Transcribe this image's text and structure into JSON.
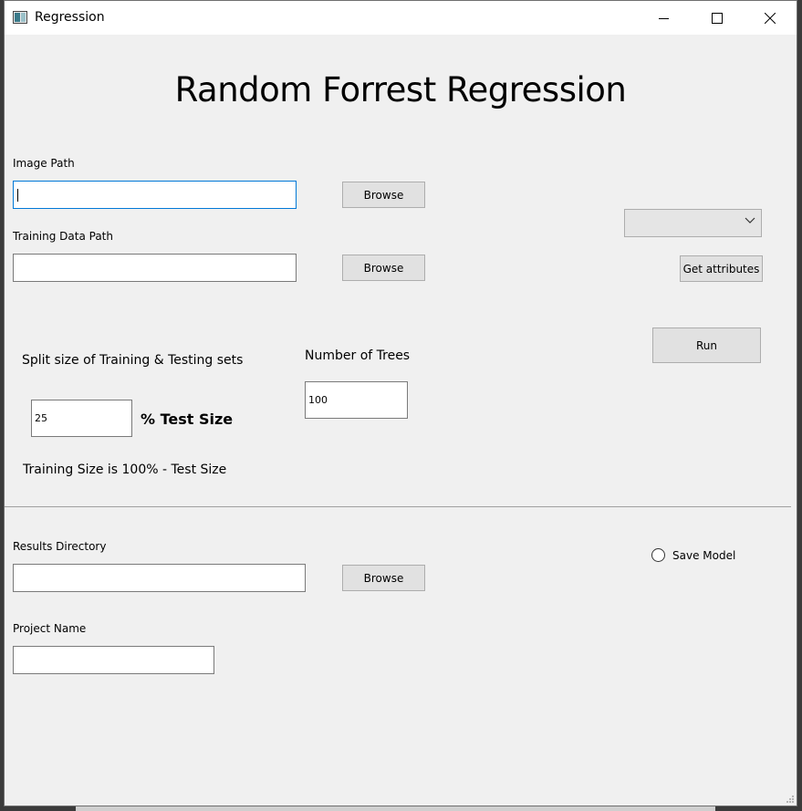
{
  "window": {
    "title": "Regression",
    "controls": [
      "minimize-icon",
      "maximize-icon",
      "close-icon"
    ]
  },
  "heading": "Random Forrest Regression",
  "image_path": {
    "label": "Image Path",
    "value": "",
    "browse_label": "Browse"
  },
  "training_data": {
    "label": "Training Data Path",
    "value": "",
    "browse_label": "Browse"
  },
  "attributes": {
    "dropdown_value": "",
    "get_label": "Get attributes"
  },
  "split": {
    "label": "Split size of Training & Testing sets",
    "test_size_value": "25",
    "unit_label": "% Test Size",
    "note": "Training Size is 100%  -  Test Size"
  },
  "trees": {
    "label": "Number of Trees",
    "value": "100"
  },
  "run_label": "Run",
  "results": {
    "label": "Results Directory",
    "value": "",
    "browse_label": "Browse"
  },
  "save_model_label": "Save Model",
  "project": {
    "label": "Project Name",
    "value": ""
  },
  "colors": {
    "window_bg": "#f0f0f0",
    "button_bg": "#e1e1e1",
    "focus_border": "#0078d7"
  }
}
